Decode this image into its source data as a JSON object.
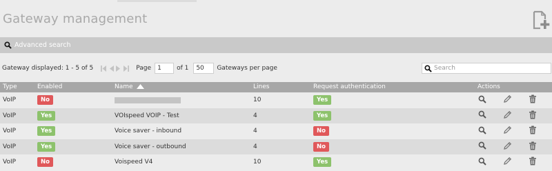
{
  "page": {
    "title": "Gateway management"
  },
  "advanced_search": {
    "label": "Advanced search"
  },
  "pager": {
    "displayed_text": "Gateway displayed: 1 - 5 of 5",
    "page_label": "Page",
    "page_value": "1",
    "of_text": "of 1",
    "per_page_value": "50",
    "per_page_label": "Gateways per page"
  },
  "search": {
    "placeholder": "Search"
  },
  "table": {
    "headers": {
      "type": "Type",
      "enabled": "Enabled",
      "name": "Name",
      "lines": "Lines",
      "request_auth": "Request authentication",
      "actions": "Actions"
    },
    "rows": [
      {
        "type": "VoIP",
        "enabled": "No",
        "name": "",
        "lines": "10",
        "request_auth": "Yes"
      },
      {
        "type": "VoIP",
        "enabled": "Yes",
        "name": "VOIspeed VOIP - Test",
        "lines": "4",
        "request_auth": "Yes"
      },
      {
        "type": "VoIP",
        "enabled": "Yes",
        "name": "Voice saver - inbound",
        "lines": "4",
        "request_auth": "No"
      },
      {
        "type": "VoIP",
        "enabled": "Yes",
        "name": "Voice saver - outbound",
        "lines": "4",
        "request_auth": "No"
      },
      {
        "type": "VoIP",
        "enabled": "No",
        "name": "Voispeed V4",
        "lines": "10",
        "request_auth": "Yes"
      }
    ]
  },
  "icons": {
    "add": "add-document-icon",
    "search": "magnifier-icon",
    "nav": [
      "first-page-icon",
      "prev-page-icon",
      "next-page-icon",
      "last-page-icon"
    ],
    "sort": "sort-ascending-icon",
    "view": "magnifier-icon",
    "edit": "pencil-icon",
    "delete": "trash-icon"
  },
  "colors": {
    "yes_badge": "#8dc26c",
    "no_badge": "#e0585a",
    "header_bg": "#a7a7a7",
    "search_bar_bg": "#c9c9c9"
  }
}
